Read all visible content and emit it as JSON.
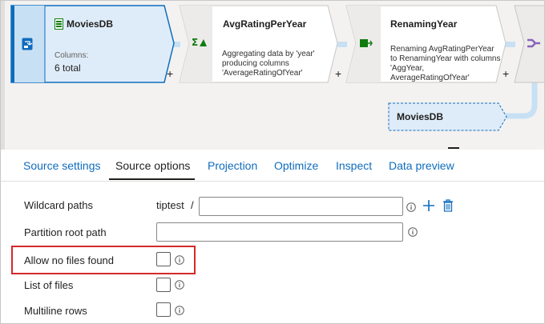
{
  "pipeline": {
    "nodes": [
      {
        "title": "MoviesDB",
        "columns_label": "Columns:",
        "columns_value": "6 total",
        "icon": "source-icon",
        "title_icon": "dataset-icon"
      },
      {
        "title": "AvgRatingPerYear",
        "description": "Aggregating data by 'year' producing columns 'AverageRatingOfYear'",
        "icon": "aggregate-icon"
      },
      {
        "title": "RenamingYear",
        "description": "Renaming AvgRatingPerYear to RenamingYear with columns 'AggYear, AverageRatingOfYear'",
        "icon": "select-icon"
      }
    ],
    "branch_node": {
      "title": "MoviesDB"
    },
    "add_symbol": "+",
    "colors": {
      "selected_fill": "#deecf9",
      "selected_border": "#0f6cbd",
      "connector": "#c7e0f4"
    }
  },
  "tabs": [
    {
      "label": "Source settings",
      "active": false
    },
    {
      "label": "Source options",
      "active": true
    },
    {
      "label": "Projection",
      "active": false
    },
    {
      "label": "Optimize",
      "active": false
    },
    {
      "label": "Inspect",
      "active": false
    },
    {
      "label": "Data preview",
      "active": false
    }
  ],
  "form": {
    "wildcard_label": "Wildcard paths",
    "wildcard_prefix": "tiptest",
    "wildcard_separator": "/",
    "wildcard_value": "",
    "partition_label": "Partition root path",
    "partition_value": "",
    "allow_no_files_label": "Allow no files found",
    "allow_no_files_checked": false,
    "list_of_files_label": "List of files",
    "list_of_files_checked": false,
    "multiline_label": "Multiline rows",
    "multiline_checked": false
  },
  "highlight_color": "#d62828"
}
